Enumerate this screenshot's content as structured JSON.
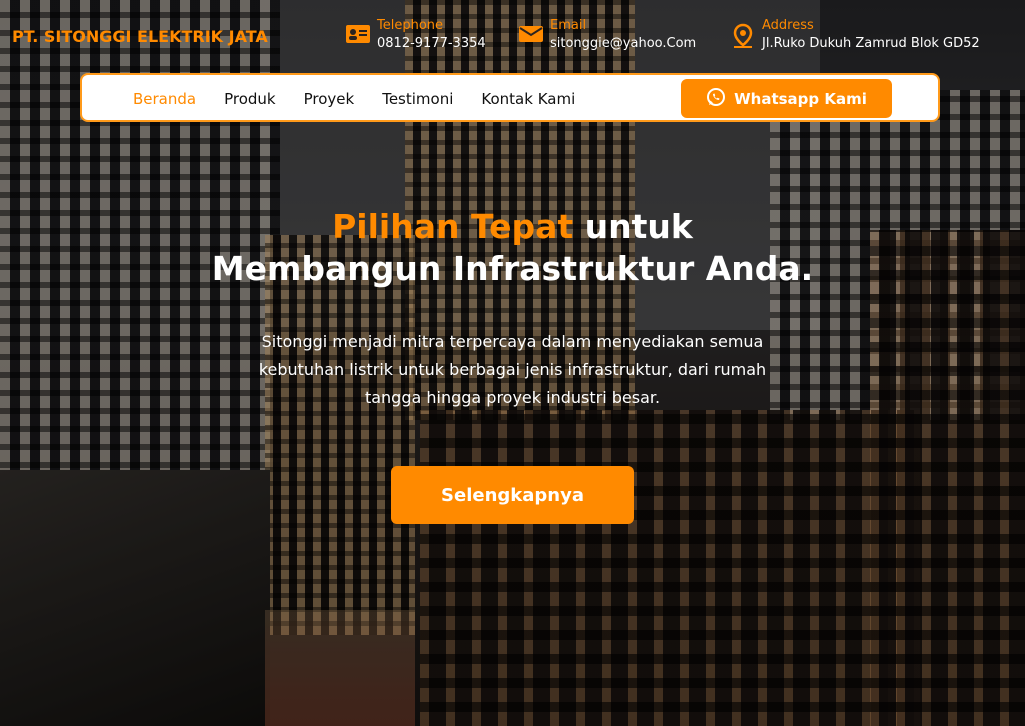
{
  "brand": {
    "name": "PT. SITONGGI ELEKTRIK JATA"
  },
  "contacts": [
    {
      "icon": "id-card-icon",
      "label": "Telephone",
      "value": "0812-9177-3354"
    },
    {
      "icon": "envelope-icon",
      "label": "Email",
      "value": "sitonggie@yahoo.Com"
    },
    {
      "icon": "map-pin-icon",
      "label": "Address",
      "value": "Jl.Ruko Dukuh Zamrud Blok GD52"
    }
  ],
  "nav": {
    "items": [
      {
        "label": "Beranda",
        "active": true
      },
      {
        "label": "Produk"
      },
      {
        "label": "Proyek"
      },
      {
        "label": "Testimoni"
      },
      {
        "label": "Kontak Kami"
      }
    ],
    "whatsapp_label": "Whatsapp Kami",
    "whatsapp_icon": "whatsapp-icon"
  },
  "hero": {
    "title_accent": "Pilihan Tepat",
    "title_rest": " untuk",
    "title_line2": "Membangun Infrastruktur Anda.",
    "description": "Sitonggi menjadi mitra terpercaya dalam menyediakan semua kebutuhan listrik untuk berbagai jenis infrastruktur, dari rumah tangga hingga proyek industri besar.",
    "cta_label": "Selengkapnya"
  },
  "colors": {
    "accent": "#ff8a00",
    "nav_bg": "#ffffff",
    "text": "#ffffff"
  }
}
